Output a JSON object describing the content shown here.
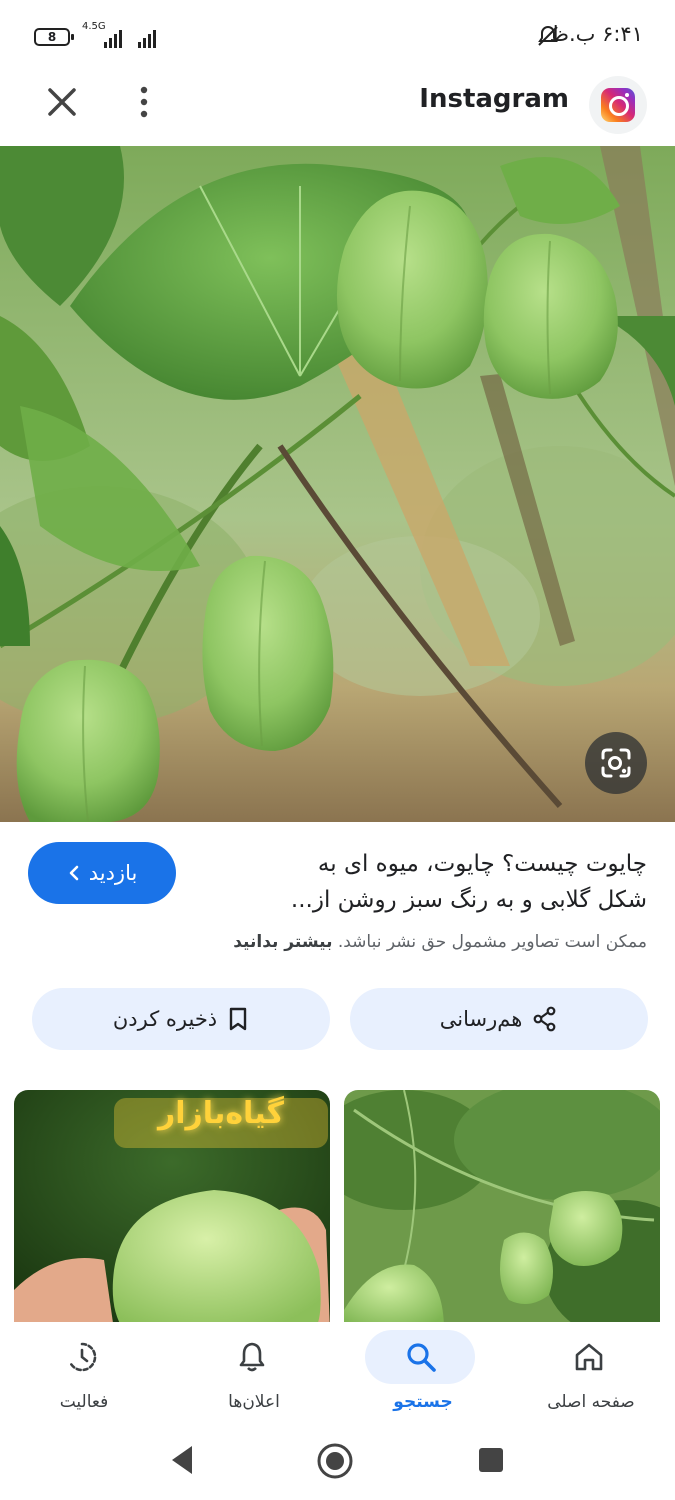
{
  "status": {
    "time": "۶:۴۱ ب.ظ",
    "battery": "8",
    "network": "4.5G"
  },
  "header": {
    "site_name": "Instagram"
  },
  "result": {
    "visit_label": "بازدید",
    "caption_line1": "چایوت چیست؟ چایوت، میوه ای به",
    "caption_line2": "شکل گلابی و به رنگ سبز روشن از...",
    "copyright_text": "ممکن است تصاویر مشمول حق نشر نباشد.",
    "learn_more": "بیشتر بدانید",
    "share_label": "هم‌رسانی",
    "save_label": "ذخیره کردن"
  },
  "related": {
    "overlay_text": "گیاه‌بازار"
  },
  "nav": {
    "items": [
      {
        "label": "صفحه اصلی",
        "icon": "home-icon"
      },
      {
        "label": "جستجو",
        "icon": "search-icon",
        "active": true
      },
      {
        "label": "اعلان‌ها",
        "icon": "bell-icon"
      },
      {
        "label": "فعالیت",
        "icon": "activity-icon"
      }
    ]
  },
  "colors": {
    "accent": "#1a73e8",
    "pill": "#e8f0fe",
    "leaf": "#5f9a3a",
    "fruit": "#8cc45e"
  }
}
